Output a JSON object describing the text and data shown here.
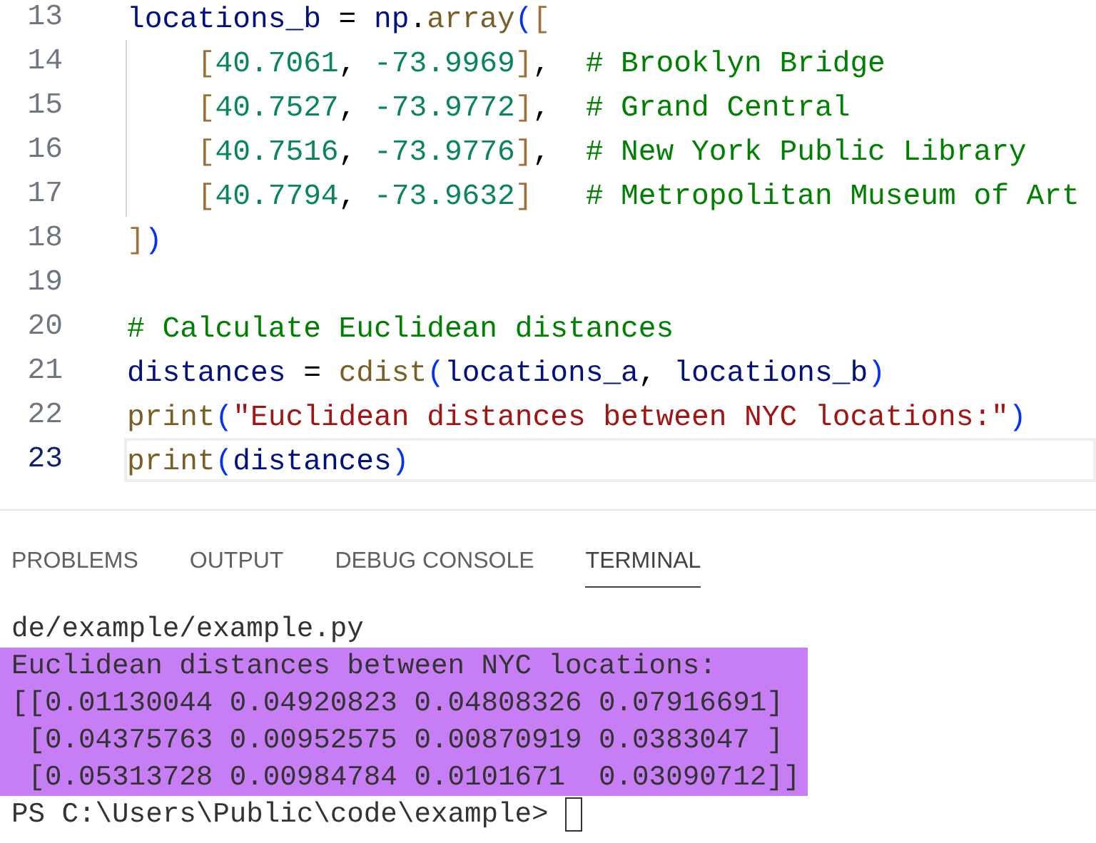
{
  "editor": {
    "lines": [
      {
        "number": "13",
        "current": false,
        "tokens": [
          {
            "kind": "var",
            "text": "locations_b"
          },
          {
            "kind": "plain",
            "text": " = "
          },
          {
            "kind": "var",
            "text": "np"
          },
          {
            "kind": "plain",
            "text": "."
          },
          {
            "kind": "fn",
            "text": "array"
          },
          {
            "kind": "paren",
            "text": "("
          },
          {
            "kind": "bracket",
            "text": "["
          }
        ]
      },
      {
        "number": "14",
        "current": false,
        "indent_guide": true,
        "tokens": [
          {
            "kind": "bracket",
            "text": "["
          },
          {
            "kind": "num",
            "text": "40.7061"
          },
          {
            "kind": "plain",
            "text": ", "
          },
          {
            "kind": "num",
            "text": "-73.9969"
          },
          {
            "kind": "bracket",
            "text": "]"
          },
          {
            "kind": "plain",
            "text": ",  "
          },
          {
            "kind": "comment",
            "text": "# Brooklyn Bridge"
          }
        ]
      },
      {
        "number": "15",
        "current": false,
        "indent_guide": true,
        "tokens": [
          {
            "kind": "bracket",
            "text": "["
          },
          {
            "kind": "num",
            "text": "40.7527"
          },
          {
            "kind": "plain",
            "text": ", "
          },
          {
            "kind": "num",
            "text": "-73.9772"
          },
          {
            "kind": "bracket",
            "text": "]"
          },
          {
            "kind": "plain",
            "text": ",  "
          },
          {
            "kind": "comment",
            "text": "# Grand Central"
          }
        ]
      },
      {
        "number": "16",
        "current": false,
        "indent_guide": true,
        "tokens": [
          {
            "kind": "bracket",
            "text": "["
          },
          {
            "kind": "num",
            "text": "40.7516"
          },
          {
            "kind": "plain",
            "text": ", "
          },
          {
            "kind": "num",
            "text": "-73.9776"
          },
          {
            "kind": "bracket",
            "text": "]"
          },
          {
            "kind": "plain",
            "text": ",  "
          },
          {
            "kind": "comment",
            "text": "# New York Public Library"
          }
        ]
      },
      {
        "number": "17",
        "current": false,
        "indent_guide": true,
        "tokens": [
          {
            "kind": "bracket",
            "text": "["
          },
          {
            "kind": "num",
            "text": "40.7794"
          },
          {
            "kind": "plain",
            "text": ", "
          },
          {
            "kind": "num",
            "text": "-73.9632"
          },
          {
            "kind": "bracket",
            "text": "]   "
          },
          {
            "kind": "comment",
            "text": "# Metropolitan Museum of Art"
          }
        ]
      },
      {
        "number": "18",
        "current": false,
        "tokens": [
          {
            "kind": "bracket",
            "text": "]"
          },
          {
            "kind": "paren",
            "text": ")"
          }
        ]
      },
      {
        "number": "19",
        "current": false
      },
      {
        "number": "20",
        "current": false,
        "tokens": [
          {
            "kind": "comment",
            "text": "# Calculate Euclidean distances"
          }
        ]
      },
      {
        "number": "21",
        "current": false,
        "tokens": [
          {
            "kind": "var",
            "text": "distances"
          },
          {
            "kind": "plain",
            "text": " = "
          },
          {
            "kind": "fn",
            "text": "cdist"
          },
          {
            "kind": "paren",
            "text": "("
          },
          {
            "kind": "var",
            "text": "locations_a"
          },
          {
            "kind": "plain",
            "text": ", "
          },
          {
            "kind": "var",
            "text": "locations_b"
          },
          {
            "kind": "paren",
            "text": ")"
          }
        ]
      },
      {
        "number": "22",
        "current": false,
        "tokens": [
          {
            "kind": "fn",
            "text": "print"
          },
          {
            "kind": "paren",
            "text": "("
          },
          {
            "kind": "str",
            "text": "\"Euclidean distances between NYC locations:\""
          },
          {
            "kind": "paren",
            "text": ")"
          }
        ]
      },
      {
        "number": "23",
        "current": true,
        "tokens": [
          {
            "kind": "fn",
            "text": "print"
          },
          {
            "kind": "paren",
            "text": "("
          },
          {
            "kind": "var",
            "text": "distances"
          },
          {
            "kind": "paren",
            "text": ")"
          }
        ]
      }
    ]
  },
  "panel": {
    "tabs": [
      {
        "label": "PROBLEMS",
        "selected": false
      },
      {
        "label": "OUTPUT",
        "selected": false
      },
      {
        "label": "DEBUG CONSOLE",
        "selected": false
      },
      {
        "label": "TERMINAL",
        "selected": true
      }
    ],
    "terminal": {
      "lines": [
        {
          "text": "de/example/example.py",
          "highlighted": false
        },
        {
          "text": "Euclidean distances between NYC locations:",
          "highlighted": true
        },
        {
          "text": "[[0.01130044 0.04920823 0.04808326 0.07916691]",
          "highlighted": true
        },
        {
          "text": " [0.04375763 0.00952575 0.00870919 0.0383047 ]",
          "highlighted": true
        },
        {
          "text": " [0.05313728 0.00984784 0.0101671  0.03090712]]",
          "highlighted": true
        }
      ],
      "prompt": "PS C:\\Users\\Public\\code\\example> "
    }
  }
}
